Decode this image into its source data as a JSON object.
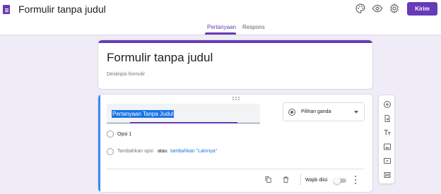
{
  "app": {
    "title": "Formulir tanpa judul",
    "icon": "forms-app-icon"
  },
  "toolbar": {
    "icons": [
      "palette-icon",
      "preview-eye-icon",
      "settings-gear-icon"
    ],
    "send_label": "Kirim"
  },
  "tabs": [
    {
      "label": "Pertanyaan",
      "active": true
    },
    {
      "label": "Respons",
      "active": false
    }
  ],
  "form": {
    "title": "Formulir tanpa judul",
    "description_placeholder": "Deskripsi formulir"
  },
  "question": {
    "title": "Pertanyaan Tanpa Judul",
    "type": "Pilihan ganda",
    "options": [
      {
        "label": "Opsi 1"
      }
    ],
    "add_option": {
      "label": "Tambahkan opsi",
      "connector": "atau",
      "add_other": "tambahkan \"Lainnya\""
    },
    "footer": {
      "required_label": "Wajib diisi",
      "required": false
    }
  },
  "side_tools": [
    "add-question-icon",
    "import-questions-icon",
    "add-title-icon",
    "add-image-icon",
    "add-video-icon",
    "add-section-icon"
  ],
  "colors": {
    "accent": "#673ab7",
    "background": "#efebf7",
    "link": "#1a73e8",
    "active_card": "#4285f4"
  }
}
